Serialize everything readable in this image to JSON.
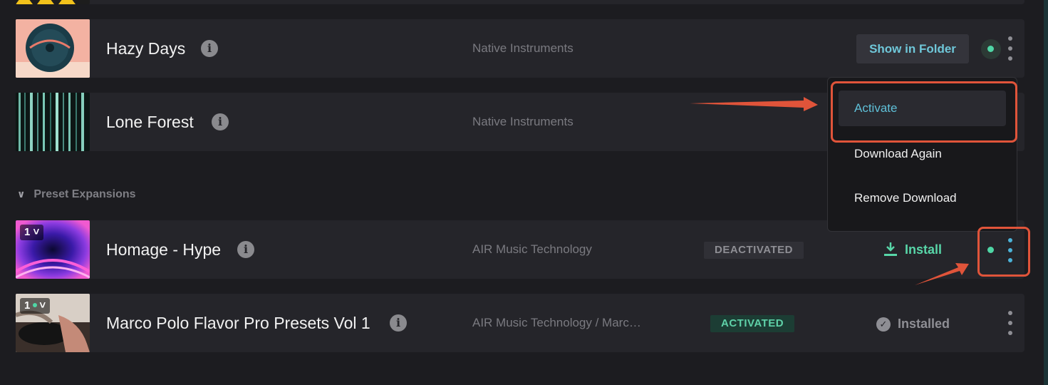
{
  "products": [
    {
      "title": "Hazy Days",
      "vendor": "Native Instruments",
      "folder_button": "Show in Folder"
    },
    {
      "title": "Lone Forest",
      "vendor": "Native Instruments"
    }
  ],
  "section": {
    "label": "Preset Expansions"
  },
  "expansions": [
    {
      "title": "Homage - Hype",
      "vendor": "AIR Music Technology",
      "status": "DEACTIVATED",
      "action": "Install",
      "count": "1"
    },
    {
      "title": "Marco Polo Flavor Pro Presets Vol 1",
      "vendor": "AIR Music Technology / Marc…",
      "status": "ACTIVATED",
      "action": "Installed",
      "count": "1"
    }
  ],
  "context_menu": {
    "items": [
      "Activate",
      "Download Again",
      "Remove Download"
    ]
  },
  "colors": {
    "accent_teal": "#4fd6a5",
    "accent_blue": "#4cb2d8",
    "annotation_red": "#e0543a"
  }
}
